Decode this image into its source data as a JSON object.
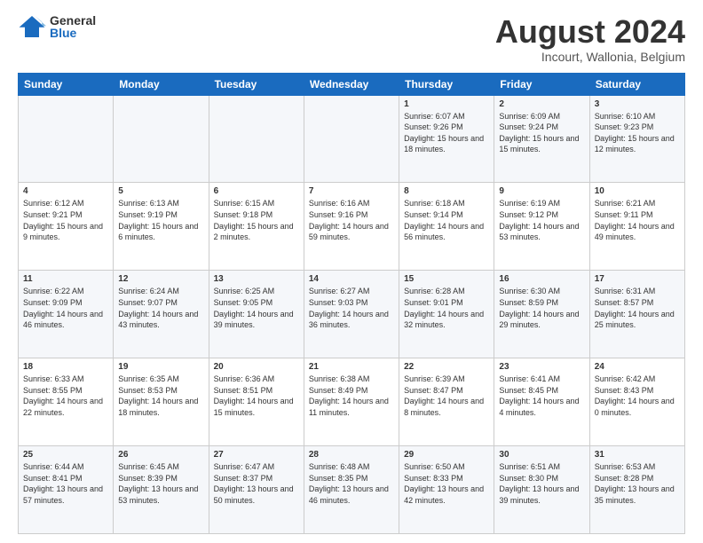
{
  "header": {
    "logo_general": "General",
    "logo_blue": "Blue",
    "title": "August 2024",
    "subtitle": "Incourt, Wallonia, Belgium"
  },
  "days_of_week": [
    "Sunday",
    "Monday",
    "Tuesday",
    "Wednesday",
    "Thursday",
    "Friday",
    "Saturday"
  ],
  "weeks": [
    [
      {
        "day": "",
        "info": ""
      },
      {
        "day": "",
        "info": ""
      },
      {
        "day": "",
        "info": ""
      },
      {
        "day": "",
        "info": ""
      },
      {
        "day": "1",
        "info": "Sunrise: 6:07 AM\nSunset: 9:26 PM\nDaylight: 15 hours\nand 18 minutes."
      },
      {
        "day": "2",
        "info": "Sunrise: 6:09 AM\nSunset: 9:24 PM\nDaylight: 15 hours\nand 15 minutes."
      },
      {
        "day": "3",
        "info": "Sunrise: 6:10 AM\nSunset: 9:23 PM\nDaylight: 15 hours\nand 12 minutes."
      }
    ],
    [
      {
        "day": "4",
        "info": "Sunrise: 6:12 AM\nSunset: 9:21 PM\nDaylight: 15 hours\nand 9 minutes."
      },
      {
        "day": "5",
        "info": "Sunrise: 6:13 AM\nSunset: 9:19 PM\nDaylight: 15 hours\nand 6 minutes."
      },
      {
        "day": "6",
        "info": "Sunrise: 6:15 AM\nSunset: 9:18 PM\nDaylight: 15 hours\nand 2 minutes."
      },
      {
        "day": "7",
        "info": "Sunrise: 6:16 AM\nSunset: 9:16 PM\nDaylight: 14 hours\nand 59 minutes."
      },
      {
        "day": "8",
        "info": "Sunrise: 6:18 AM\nSunset: 9:14 PM\nDaylight: 14 hours\nand 56 minutes."
      },
      {
        "day": "9",
        "info": "Sunrise: 6:19 AM\nSunset: 9:12 PM\nDaylight: 14 hours\nand 53 minutes."
      },
      {
        "day": "10",
        "info": "Sunrise: 6:21 AM\nSunset: 9:11 PM\nDaylight: 14 hours\nand 49 minutes."
      }
    ],
    [
      {
        "day": "11",
        "info": "Sunrise: 6:22 AM\nSunset: 9:09 PM\nDaylight: 14 hours\nand 46 minutes."
      },
      {
        "day": "12",
        "info": "Sunrise: 6:24 AM\nSunset: 9:07 PM\nDaylight: 14 hours\nand 43 minutes."
      },
      {
        "day": "13",
        "info": "Sunrise: 6:25 AM\nSunset: 9:05 PM\nDaylight: 14 hours\nand 39 minutes."
      },
      {
        "day": "14",
        "info": "Sunrise: 6:27 AM\nSunset: 9:03 PM\nDaylight: 14 hours\nand 36 minutes."
      },
      {
        "day": "15",
        "info": "Sunrise: 6:28 AM\nSunset: 9:01 PM\nDaylight: 14 hours\nand 32 minutes."
      },
      {
        "day": "16",
        "info": "Sunrise: 6:30 AM\nSunset: 8:59 PM\nDaylight: 14 hours\nand 29 minutes."
      },
      {
        "day": "17",
        "info": "Sunrise: 6:31 AM\nSunset: 8:57 PM\nDaylight: 14 hours\nand 25 minutes."
      }
    ],
    [
      {
        "day": "18",
        "info": "Sunrise: 6:33 AM\nSunset: 8:55 PM\nDaylight: 14 hours\nand 22 minutes."
      },
      {
        "day": "19",
        "info": "Sunrise: 6:35 AM\nSunset: 8:53 PM\nDaylight: 14 hours\nand 18 minutes."
      },
      {
        "day": "20",
        "info": "Sunrise: 6:36 AM\nSunset: 8:51 PM\nDaylight: 14 hours\nand 15 minutes."
      },
      {
        "day": "21",
        "info": "Sunrise: 6:38 AM\nSunset: 8:49 PM\nDaylight: 14 hours\nand 11 minutes."
      },
      {
        "day": "22",
        "info": "Sunrise: 6:39 AM\nSunset: 8:47 PM\nDaylight: 14 hours\nand 8 minutes."
      },
      {
        "day": "23",
        "info": "Sunrise: 6:41 AM\nSunset: 8:45 PM\nDaylight: 14 hours\nand 4 minutes."
      },
      {
        "day": "24",
        "info": "Sunrise: 6:42 AM\nSunset: 8:43 PM\nDaylight: 14 hours\nand 0 minutes."
      }
    ],
    [
      {
        "day": "25",
        "info": "Sunrise: 6:44 AM\nSunset: 8:41 PM\nDaylight: 13 hours\nand 57 minutes."
      },
      {
        "day": "26",
        "info": "Sunrise: 6:45 AM\nSunset: 8:39 PM\nDaylight: 13 hours\nand 53 minutes."
      },
      {
        "day": "27",
        "info": "Sunrise: 6:47 AM\nSunset: 8:37 PM\nDaylight: 13 hours\nand 50 minutes."
      },
      {
        "day": "28",
        "info": "Sunrise: 6:48 AM\nSunset: 8:35 PM\nDaylight: 13 hours\nand 46 minutes."
      },
      {
        "day": "29",
        "info": "Sunrise: 6:50 AM\nSunset: 8:33 PM\nDaylight: 13 hours\nand 42 minutes."
      },
      {
        "day": "30",
        "info": "Sunrise: 6:51 AM\nSunset: 8:30 PM\nDaylight: 13 hours\nand 39 minutes."
      },
      {
        "day": "31",
        "info": "Sunrise: 6:53 AM\nSunset: 8:28 PM\nDaylight: 13 hours\nand 35 minutes."
      }
    ]
  ]
}
